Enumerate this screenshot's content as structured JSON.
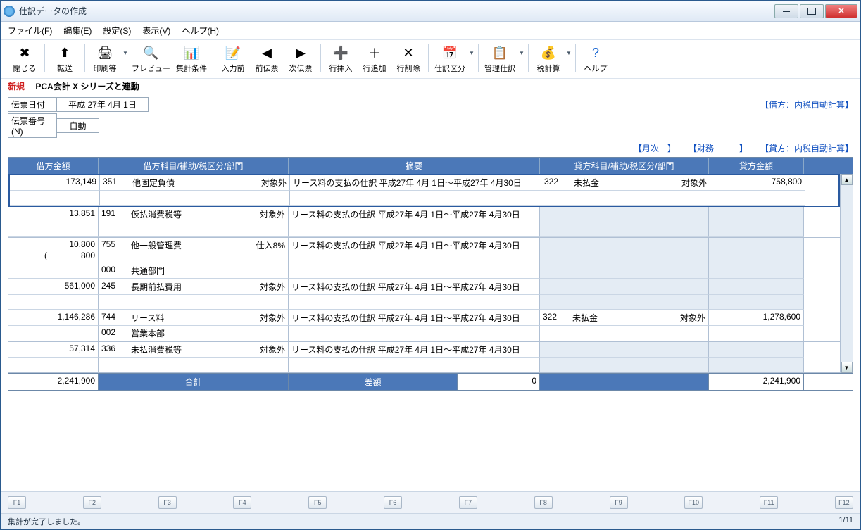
{
  "window": {
    "title": "仕訳データの作成"
  },
  "menu": {
    "file": "ファイル(F)",
    "edit": "編集(E)",
    "settings": "設定(S)",
    "view": "表示(V)",
    "help": "ヘルプ(H)"
  },
  "toolbar": {
    "close": "閉じる",
    "transfer": "転送",
    "print": "印刷等",
    "preview": "プレビュー",
    "criteria": "集計条件",
    "preinput": "入力前",
    "prevslip": "前伝票",
    "nextslip": "次伝票",
    "insrow": "行挿入",
    "addrow": "行追加",
    "delrow": "行削除",
    "jclass": "仕訳区分",
    "mgmt": "管理仕訳",
    "tax": "税計算",
    "help": "ヘルプ"
  },
  "header": {
    "new": "新規",
    "link": "PCA会計 X シリーズと連動"
  },
  "form": {
    "date_label": "伝票日付",
    "date_value": "平成 27年  4月  1日",
    "no_label": "伝票番号(N)",
    "no_value": "自動"
  },
  "right_info": {
    "debit_auto": "【借方：内税自動計算】",
    "credit_auto": "【貸方：内税自動計算】",
    "monthly": "【月次　】",
    "fin": "【財務　　　】"
  },
  "grid": {
    "h_damt": "借方金額",
    "h_dacc": "借方科目/補助/税区分/部門",
    "h_memo": "摘要",
    "h_cacc": "貸方科目/補助/税区分/部門",
    "h_camt": "貸方金額"
  },
  "rows": [
    {
      "damt": "173,149",
      "dcode": "351",
      "dname": "他固定負債",
      "dtax": "対象外",
      "memo": "リース料の支払の仕訳 平成27年 4月 1日～平成27年 4月30日",
      "ccode": "322",
      "cname": "未払金",
      "ctax": "対象外",
      "camt": "758,800",
      "dsubcode": "",
      "dsubname": "",
      "sel": true
    },
    {
      "damt": "13,851",
      "dcode": "191",
      "dname": "仮払消費税等",
      "dtax": "対象外",
      "memo": "リース料の支払の仕訳 平成27年 4月 1日～平成27年 4月30日",
      "ccode": "",
      "cname": "",
      "ctax": "",
      "camt": "",
      "dsubcode": "",
      "dsubname": ""
    },
    {
      "damt": "10,800",
      "damt2": "(　　　　800",
      "dcode": "755",
      "dname": "他一般管理費",
      "dtax": "仕入8%",
      "memo": "リース料の支払の仕訳 平成27年 4月 1日～平成27年 4月30日",
      "ccode": "",
      "cname": "",
      "ctax": "",
      "camt": "",
      "dsubcode": "000",
      "dsubname": "共通部門"
    },
    {
      "damt": "561,000",
      "dcode": "245",
      "dname": "長期前払費用",
      "dtax": "対象外",
      "memo": "リース料の支払の仕訳 平成27年 4月 1日～平成27年 4月30日",
      "ccode": "",
      "cname": "",
      "ctax": "",
      "camt": "",
      "dsubcode": "",
      "dsubname": ""
    },
    {
      "damt": "1,146,286",
      "dcode": "744",
      "dname": "リース料",
      "dtax": "対象外",
      "memo": "リース料の支払の仕訳 平成27年 4月 1日～平成27年 4月30日",
      "ccode": "322",
      "cname": "未払金",
      "ctax": "対象外",
      "camt": "1,278,600",
      "dsubcode": "002",
      "dsubname": "営業本部"
    },
    {
      "damt": "57,314",
      "dcode": "336",
      "dname": "未払消費税等",
      "dtax": "対象外",
      "memo": "リース料の支払の仕訳 平成27年 4月 1日～平成27年 4月30日",
      "ccode": "",
      "cname": "",
      "ctax": "",
      "camt": "",
      "dsubcode": "",
      "dsubname": ""
    }
  ],
  "sum": {
    "dtotal": "2,241,900",
    "label_total": "合計",
    "label_diff": "差額",
    "diff": "0",
    "ctotal": "2,241,900"
  },
  "fkeys": [
    "F1",
    "F2",
    "F3",
    "F4",
    "F5",
    "F6",
    "F7",
    "F8",
    "F9",
    "F10",
    "F11",
    "F12"
  ],
  "status": {
    "msg": "集計が完了しました。",
    "page": "1/11"
  }
}
